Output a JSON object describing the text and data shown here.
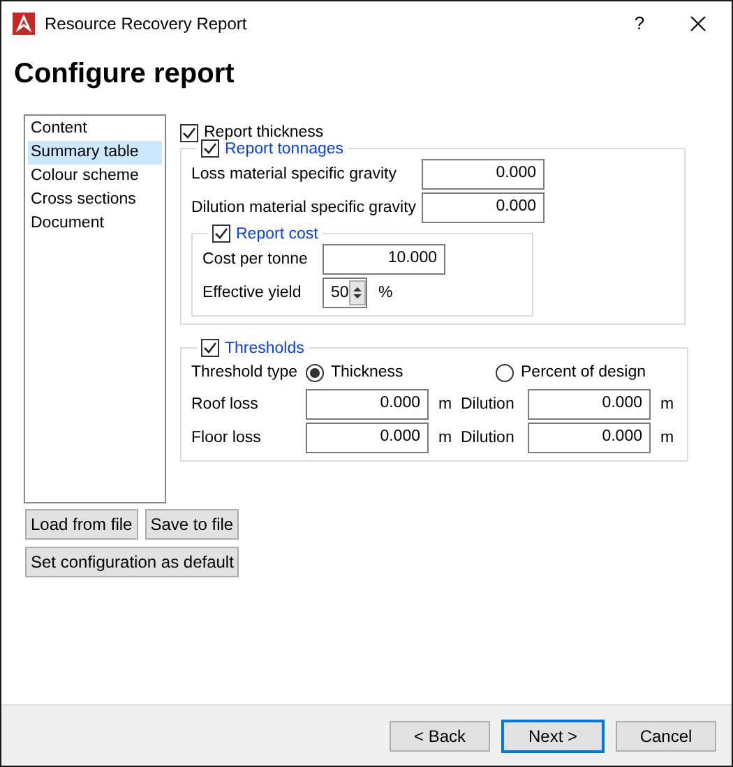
{
  "window": {
    "title": "Resource Recovery Report",
    "help": "?"
  },
  "heading": "Configure report",
  "nav": [
    {
      "label": "Content",
      "selected": false
    },
    {
      "label": "Summary table",
      "selected": true
    },
    {
      "label": "Colour scheme",
      "selected": false
    },
    {
      "label": "Cross sections",
      "selected": false
    },
    {
      "label": "Document",
      "selected": false
    }
  ],
  "report_thickness": {
    "label": "Report thickness",
    "checked": true
  },
  "tonnages": {
    "label": "Report tonnages",
    "checked": true,
    "fields": [
      {
        "label": "Loss material specific gravity",
        "value": "0.000"
      },
      {
        "label": "Dilution material specific gravity",
        "value": "0.000"
      }
    ],
    "cost": {
      "label": "Report cost",
      "checked": true,
      "cost_per_tonne": {
        "label": "Cost per tonne",
        "value": "10.000"
      },
      "yield": {
        "label": "Effective yield",
        "value": "50",
        "unit": "%"
      }
    }
  },
  "thresholds": {
    "label": "Thresholds",
    "checked": true,
    "type_label": "Threshold type",
    "options": [
      {
        "label": "Thickness",
        "selected": true
      },
      {
        "label": "Percent of design",
        "selected": false
      }
    ],
    "rows": [
      {
        "label": "Roof loss",
        "value": "0.000",
        "unit": "m",
        "dilution_label": "Dilution",
        "dilution_value": "0.000",
        "dilution_unit": "m"
      },
      {
        "label": "Floor loss",
        "value": "0.000",
        "unit": "m",
        "dilution_label": "Dilution",
        "dilution_value": "0.000",
        "dilution_unit": "m"
      }
    ]
  },
  "file_buttons": [
    "Load from file",
    "Save to file"
  ],
  "default_button": "Set configuration as default",
  "footer_buttons": [
    {
      "label": "< Back",
      "focused": false
    },
    {
      "label": "Next >",
      "focused": true
    },
    {
      "label": "Cancel",
      "focused": false
    }
  ]
}
